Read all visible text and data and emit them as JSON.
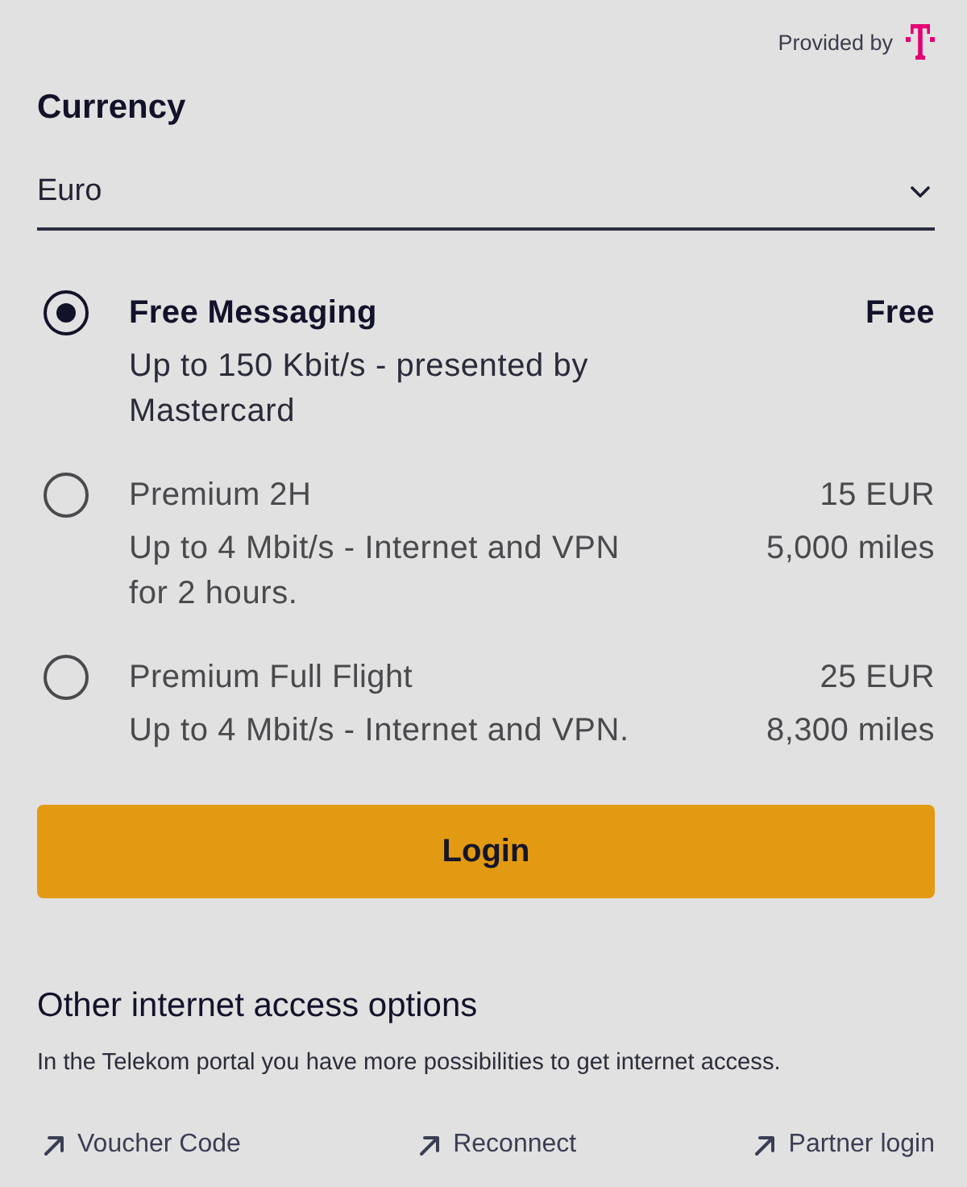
{
  "provider": {
    "label": "Provided by"
  },
  "currency": {
    "label": "Currency",
    "value": "Euro"
  },
  "plans": [
    {
      "name": "Free Messaging",
      "description": "Up to 150 Kbit/s - presented by Mastercard",
      "prices": [
        "Free"
      ],
      "selected": true
    },
    {
      "name": "Premium 2H",
      "description": "Up to 4 Mbit/s - Internet and VPN for 2 hours.",
      "prices": [
        "15 EUR",
        "5,000 miles"
      ],
      "selected": false
    },
    {
      "name": "Premium Full Flight",
      "description": "Up to 4 Mbit/s - Internet and VPN.",
      "prices": [
        "25 EUR",
        "8,300 miles"
      ],
      "selected": false
    }
  ],
  "login_button": {
    "label": "Login"
  },
  "other_options": {
    "title": "Other internet access options",
    "description": "In the Telekom portal you have more possibilities to get internet access.",
    "links": [
      {
        "label": "Voucher Code"
      },
      {
        "label": "Reconnect"
      },
      {
        "label": "Partner login"
      }
    ]
  }
}
